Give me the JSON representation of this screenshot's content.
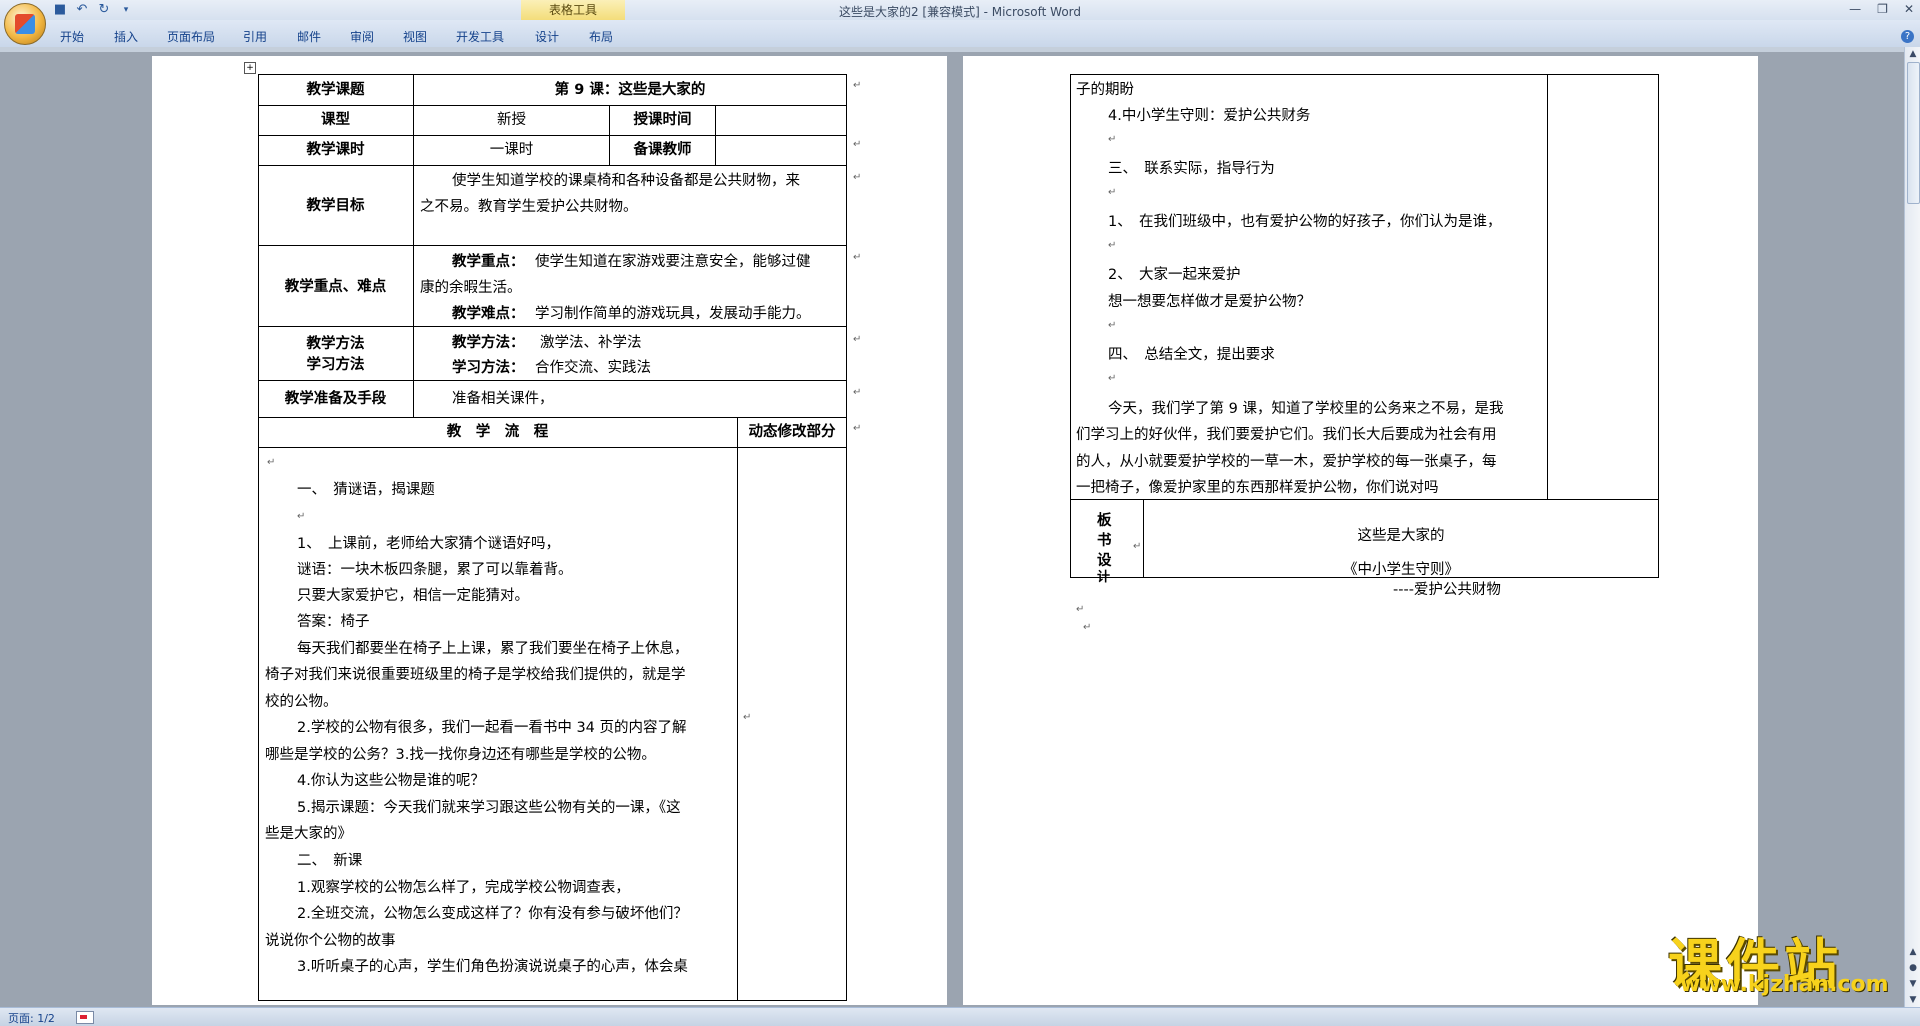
{
  "titlebar": {
    "title": "这些是大家的2 [兼容模式] - Microsoft Word",
    "context_tab_group": "表格工具"
  },
  "ribbon_tabs": [
    "开始",
    "插入",
    "页面布局",
    "引用",
    "邮件",
    "审阅",
    "视图",
    "开发工具",
    "设计",
    "布局"
  ],
  "statusbar": {
    "page": "页面: 1/2"
  },
  "watermark": {
    "title": "课件站",
    "url": "www.kjzhan.com"
  },
  "page1": {
    "table": {
      "row1": {
        "label": "教学课题",
        "value": "第 9 课：这些是大家的"
      },
      "row2": {
        "label": "课型",
        "value": "新授",
        "label2": "授课时间"
      },
      "row3": {
        "label": "教学课时",
        "value": "一课时",
        "label2": "备课教师"
      },
      "row4": {
        "label": "教学目标",
        "line1": "使学生知道学校的课桌椅和各种设备都是公共财物，来",
        "line2": "之不易。教育学生爱护公共财物。"
      },
      "row5": {
        "label": "教学重点、难点",
        "key_label": "教学重点：",
        "key_text": "使学生知道在家游戏要注意安全，能够过健",
        "key_text2": "康的余暇生活。",
        "diff_label": "教学难点：",
        "diff_text": "学习制作简单的游戏玩具，发展动手能力。"
      },
      "row6": {
        "label_line1": "教学方法",
        "label_line2": "学习方法",
        "teach_label": "教学方法：",
        "teach_text": "激学法、补学法",
        "learn_label": "学习方法：",
        "learn_text": "合作交流、实践法"
      },
      "row7": {
        "label": "教学准备及手段",
        "value": "准备相关课件，"
      },
      "flow_header": {
        "left": "教　学　流　程",
        "right": "动态修改部分"
      },
      "flow_lines": [
        "一、　猜谜语，揭课题",
        "1、　上课前，老师给大家猜个谜语好吗，",
        "谜语：一块木板四条腿，累了可以靠着背。",
        "只要大家爱护它，相信一定能猜对。",
        "答案：椅子",
        "每天我们都要坐在椅子上上课，累了我们要坐在椅子上休息，",
        "椅子对我们来说很重要班级里的椅子是学校给我们提供的，就是学",
        "校的公物。",
        "2.学校的公物有很多，我们一起看一看书中 34 页的内容了解",
        "哪些是学校的公务？3.找一找你身边还有哪些是学校的公物。",
        "4.你认为这些公物是谁的呢？",
        "5.揭示课题：今天我们就来学习跟这些公物有关的一课，《这",
        "些是大家的》",
        "二、　新课",
        "1.观察学校的公物怎么样了，完成学校公物调查表，",
        "2.全班交流，公物怎么变成这样了？你有没有参与破坏他们？",
        "说说你个公物的故事",
        "3.听听桌子的心声，学生们角色扮演说说桌子的心声，体会桌"
      ]
    }
  },
  "page2": {
    "lines": [
      "子的期盼",
      "4.中小学生守则：爱护公共财务",
      "三、　联系实际，指导行为",
      "1、　在我们班级中，也有爱护公物的好孩子，你们认为是谁，",
      "2、　大家一起来爱护",
      "想一想要怎样做才是爱护公物？",
      "四、　总结全文，提出要求",
      "今天，我们学了第 9 课，知道了学校里的公务来之不易，是我",
      "们学习上的好伙伴，我们要爱护它们。我们长大后要成为社会有用",
      "的人，从小就要爱护学校的一草一木，爱护学校的每一张桌子，每",
      "一把椅子，像爱护家里的东西那样爱护公物，你们说对吗"
    ],
    "board": {
      "label": [
        "板",
        "书",
        "设",
        "计"
      ],
      "title": "这些是大家的",
      "rule": "《中小学生守则》",
      "sub": "----爱护公共财物"
    }
  }
}
